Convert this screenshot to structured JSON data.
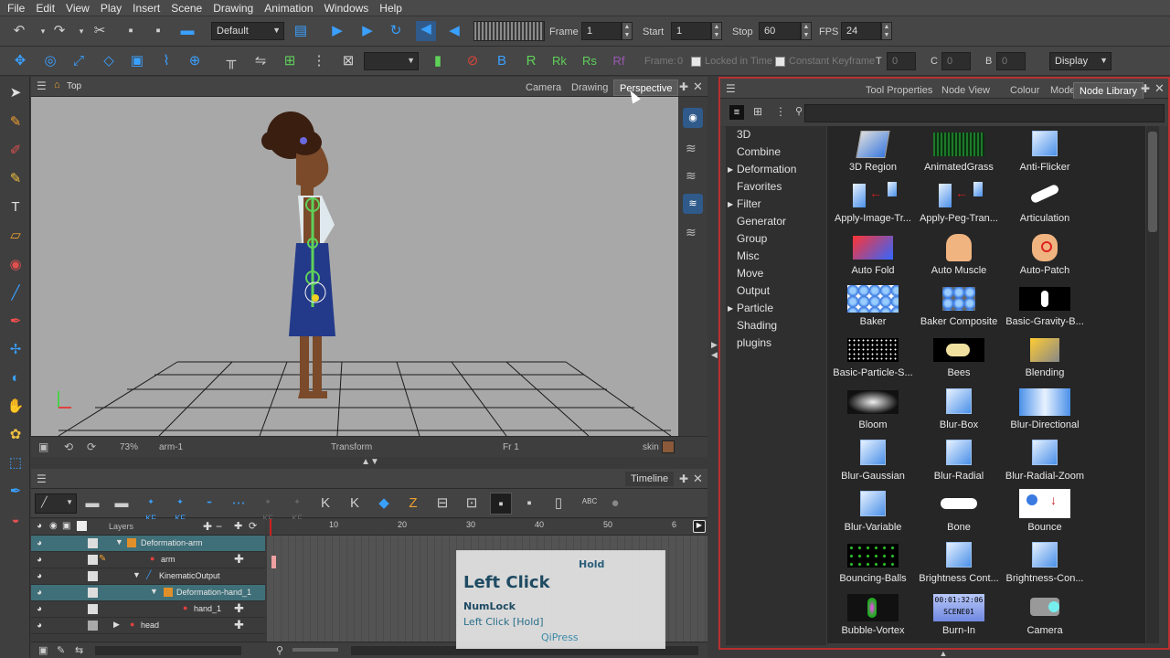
{
  "menu": [
    "File",
    "Edit",
    "View",
    "Play",
    "Insert",
    "Scene",
    "Drawing",
    "Animation",
    "Windows",
    "Help"
  ],
  "toolbar1": {
    "workspace": "Default",
    "frame_label": "Frame",
    "frame_value": "1",
    "start_label": "Start",
    "start_value": "1",
    "stop_label": "Stop",
    "stop_value": "60",
    "fps_label": "FPS",
    "fps_value": "24"
  },
  "toolbar2": {
    "frame_label": "Frame:",
    "frame_value": "0",
    "locked_label": "Locked in Time",
    "constant_label": "Constant Keyframe",
    "t_label": "T",
    "t_value": "0",
    "c_label": "C",
    "c_value": "0",
    "b_label": "B",
    "b_value": "0",
    "display_value": "Display"
  },
  "camera_view": {
    "title": "Top",
    "tabs": [
      "Camera",
      "Drawing",
      "Perspective"
    ],
    "active_tab": "Perspective",
    "status": {
      "zoom": "73%",
      "node": "arm-1",
      "tool": "Transform",
      "frame": "Fr 1",
      "swatch": "skin"
    }
  },
  "timeline": {
    "title": "Timeline",
    "layers_header": "Layers",
    "ruler": [
      "10",
      "20",
      "30",
      "40",
      "50",
      "6"
    ],
    "kf_label": "KF",
    "abc_label": "ABC",
    "layers": [
      {
        "name": "Deformation-arm",
        "selected": true
      },
      {
        "name": "arm",
        "selected": false
      },
      {
        "name": "KinematicOutput",
        "selected": false
      },
      {
        "name": "Deformation-hand_1",
        "selected": true
      },
      {
        "name": "hand_1",
        "selected": false
      },
      {
        "name": "head",
        "selected": false
      }
    ]
  },
  "keystroke_overlay": {
    "hold": "Hold",
    "main": "Left Click",
    "numlock": "NumLock",
    "detail": "Left Click [Hold]",
    "brand": "QiPress"
  },
  "node_library": {
    "tabs": [
      "Tool Properties",
      "Node View",
      "Colour",
      "Model",
      "Node Library"
    ],
    "active_tab": "Node Library",
    "categories": [
      {
        "name": "3D",
        "expandable": false
      },
      {
        "name": "Combine",
        "expandable": false
      },
      {
        "name": "Deformation",
        "expandable": true
      },
      {
        "name": "Favorites",
        "expandable": false
      },
      {
        "name": "Filter",
        "expandable": true
      },
      {
        "name": "Generator",
        "expandable": false
      },
      {
        "name": "Group",
        "expandable": false
      },
      {
        "name": "Misc",
        "expandable": false
      },
      {
        "name": "Move",
        "expandable": false
      },
      {
        "name": "Output",
        "expandable": false
      },
      {
        "name": "Particle",
        "expandable": true
      },
      {
        "name": "Shading",
        "expandable": false
      },
      {
        "name": "plugins",
        "expandable": false
      }
    ],
    "nodes": [
      {
        "label": "3D Region",
        "icon": "3d-region-icon"
      },
      {
        "label": "AnimatedGrass",
        "icon": "grass-icon"
      },
      {
        "label": "Anti-Flicker",
        "icon": "anti-flicker-icon"
      },
      {
        "label": "Apply-Image-Tr...",
        "icon": "apply-image-icon"
      },
      {
        "label": "Apply-Peg-Tran...",
        "icon": "apply-peg-icon"
      },
      {
        "label": "Articulation",
        "icon": "articulation-icon"
      },
      {
        "label": "Auto Fold",
        "icon": "auto-fold-icon"
      },
      {
        "label": "Auto Muscle",
        "icon": "auto-muscle-icon"
      },
      {
        "label": "Auto-Patch",
        "icon": "auto-patch-icon"
      },
      {
        "label": "Baker",
        "icon": "baker-icon"
      },
      {
        "label": "Baker Composite",
        "icon": "baker-composite-icon"
      },
      {
        "label": "Basic-Gravity-B...",
        "icon": "gravity-icon"
      },
      {
        "label": "Basic-Particle-S...",
        "icon": "particle-icon"
      },
      {
        "label": "Bees",
        "icon": "bees-icon"
      },
      {
        "label": "Blending",
        "icon": "blending-icon"
      },
      {
        "label": "Bloom",
        "icon": "bloom-icon"
      },
      {
        "label": "Blur-Box",
        "icon": "blur-box-icon"
      },
      {
        "label": "Blur-Directional",
        "icon": "blur-directional-icon"
      },
      {
        "label": "Blur-Gaussian",
        "icon": "blur-gaussian-icon"
      },
      {
        "label": "Blur-Radial",
        "icon": "blur-radial-icon"
      },
      {
        "label": "Blur-Radial-Zoom",
        "icon": "blur-radial-zoom-icon"
      },
      {
        "label": "Blur-Variable",
        "icon": "blur-variable-icon"
      },
      {
        "label": "Bone",
        "icon": "bone-icon"
      },
      {
        "label": "Bounce",
        "icon": "bounce-icon"
      },
      {
        "label": "Bouncing-Balls",
        "icon": "bouncing-balls-icon"
      },
      {
        "label": "Brightness Cont...",
        "icon": "brightness-icon"
      },
      {
        "label": "Brightness-Con...",
        "icon": "brightness-con-icon"
      },
      {
        "label": "Bubble-Vortex",
        "icon": "bubble-vortex-icon"
      },
      {
        "label": "Burn-In",
        "icon": "burn-in-icon"
      },
      {
        "label": "Camera",
        "icon": "camera-icon"
      }
    ],
    "burnin_text": "00:01:32:06",
    "burnin_sub": "SCENE01"
  }
}
